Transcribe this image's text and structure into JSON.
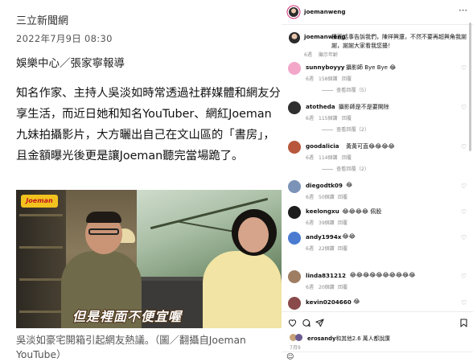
{
  "article": {
    "source": "三立新聞網",
    "date": "2022年7月9日 08:30",
    "byline": "娛樂中心／張家寧報導",
    "body": "知名作家、主持人吳淡如時常透過社群媒體和網友分享生活，而近日她和知名YouTuber、網紅Joeman 九妹拍攝影片，大方曬出自己在文山區的「書房」，且金額曝光後更是讓Joeman聽完當場跪了。",
    "photo_logo": "Joeman",
    "photo_subtitle": "但是裡面不便宜喔",
    "caption": "吳淡如豪宅開箱引起網友熱議。（圖／翻攝自Joeman YouTube）"
  },
  "instagram": {
    "header_user": "joemanweng",
    "more_icon": "⋯",
    "caption_user": "joemanweng",
    "caption_text": "檯面話事告訴我們，陳祥興還，不然不要再超興角我謝謝，謝謝大家看我您擾！",
    "caption_time": "6週",
    "caption_translate": "顯示年齡",
    "comments": [
      {
        "user": "sunnyboyyy",
        "text": "攝影師 Bye Bye 😂",
        "time": "6週",
        "likes": "158個讚",
        "reply": "回覆",
        "replies": "查看回覆（5）",
        "avatar_color": "#f2a7c9"
      },
      {
        "user": "atotheda",
        "text": "攝影師是不是要開除",
        "time": "6週",
        "likes": "115個讚",
        "reply": "回覆",
        "replies": "查看回覆（2）",
        "avatar_color": "#2f2f2f"
      },
      {
        "user": "goodalicia",
        "text": "黃黃可直😂😂😂😂",
        "time": "6週",
        "likes": "114個讚",
        "reply": "回覆",
        "replies": "查看回覆（2）",
        "avatar_color": "#b8573c"
      },
      {
        "user": "diegodtk09",
        "text": "😂",
        "time": "6週",
        "likes": "50個讚",
        "reply": "回覆",
        "replies": "",
        "avatar_color": "#7c93b8"
      },
      {
        "user": "keelongxu",
        "text": "😂😂😂😂 佩股",
        "time": "6週",
        "likes": "39個讚",
        "reply": "回覆",
        "replies": "",
        "avatar_color": "#1d1d1d"
      },
      {
        "user": "andy1994x",
        "text": "😂😂",
        "time": "6週",
        "likes": "22個讚",
        "reply": "回覆",
        "replies": "",
        "avatar_color": "#4a7bd1"
      },
      {
        "user": "linda831212",
        "text": "😂😂😂😂😂😂😂😂😂😂",
        "time": "6週",
        "likes": "20個讚",
        "reply": "回覆",
        "replies": "",
        "avatar_color": "#9e7d62"
      },
      {
        "user": "kevin0204660",
        "text": "😂",
        "time": "",
        "likes": "",
        "reply": "",
        "replies": "",
        "avatar_color": "#8a4a4a"
      }
    ],
    "likes_user": "erosandy",
    "likes_text": "和其他2.6 萬人都說讚",
    "post_date": "7月9",
    "icons": {
      "heart": "heart-icon",
      "comment": "comment-icon",
      "share": "share-icon",
      "save": "bookmark-icon"
    }
  }
}
